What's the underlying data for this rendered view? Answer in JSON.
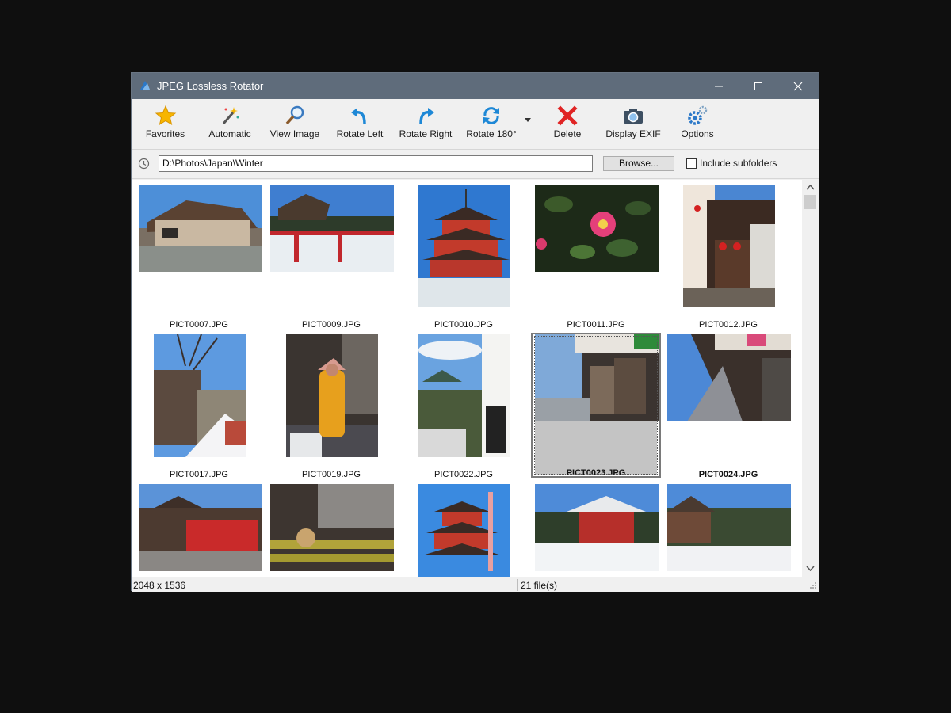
{
  "window": {
    "title": "JPEG Lossless Rotator"
  },
  "toolbar": {
    "buttons": [
      {
        "label": "Favorites",
        "icon": "star-icon"
      },
      {
        "label": "Automatic",
        "icon": "magic-wand-icon"
      },
      {
        "label": "View Image",
        "icon": "magnifier-icon"
      },
      {
        "label": "Rotate Left",
        "icon": "rotate-left-icon"
      },
      {
        "label": "Rotate Right",
        "icon": "rotate-right-icon"
      },
      {
        "label": "Rotate 180°",
        "icon": "rotate-180-icon"
      },
      {
        "label": "Delete",
        "icon": "delete-x-icon"
      },
      {
        "label": "Display EXIF",
        "icon": "camera-icon"
      },
      {
        "label": "Options",
        "icon": "gears-icon"
      }
    ]
  },
  "path": {
    "value": "D:\\Photos\\Japan\\Winter",
    "browse_label": "Browse...",
    "subfolders_label": "Include subfolders"
  },
  "files": [
    {
      "name": "PICT0007.JPG"
    },
    {
      "name": "PICT0009.JPG"
    },
    {
      "name": "PICT0010.JPG"
    },
    {
      "name": "PICT0011.JPG"
    },
    {
      "name": "PICT0012.JPG"
    },
    {
      "name": "PICT0017.JPG"
    },
    {
      "name": "PICT0019.JPG"
    },
    {
      "name": "PICT0022.JPG"
    },
    {
      "name": "PICT0023.JPG"
    },
    {
      "name": "PICT0024.JPG"
    },
    {
      "name": ""
    },
    {
      "name": ""
    },
    {
      "name": ""
    },
    {
      "name": ""
    },
    {
      "name": ""
    }
  ],
  "status": {
    "dimensions": "2048 x 1536",
    "count": "21 file(s)"
  },
  "colors": {
    "titlebar": "#5f6c7b",
    "accent": "#1e88d6",
    "delete": "#e02424"
  }
}
